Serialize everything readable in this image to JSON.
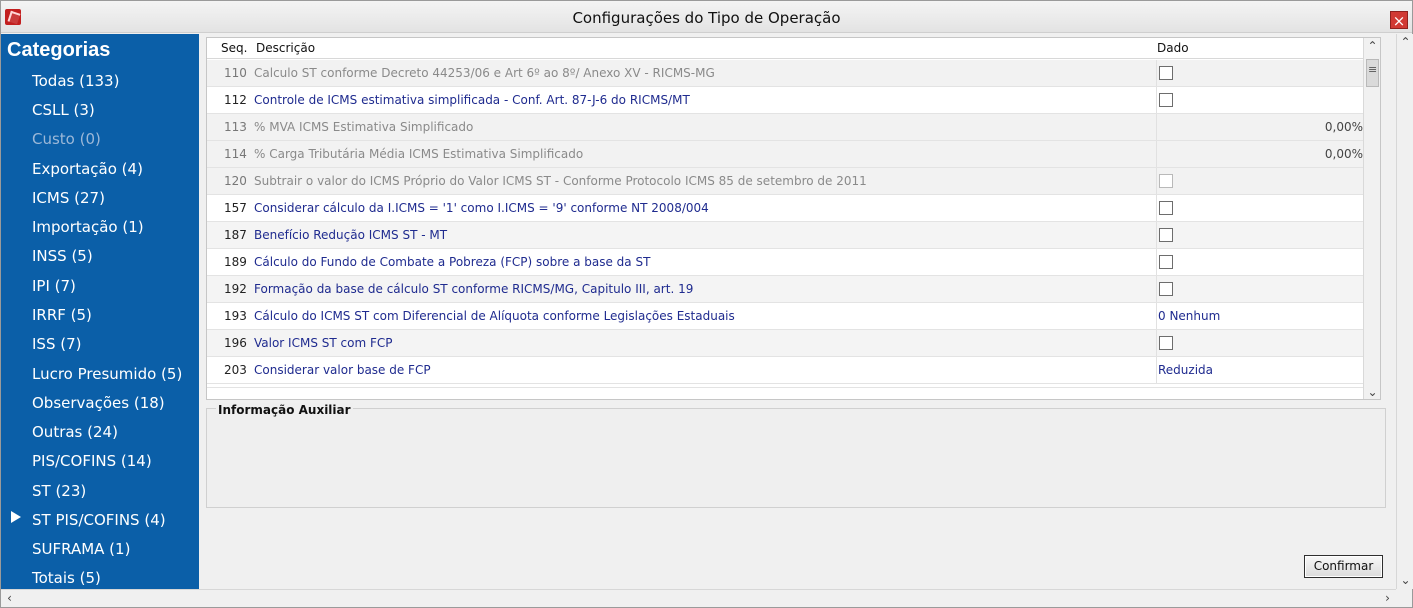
{
  "window": {
    "title": "Configurações do Tipo de Operação",
    "close_symbol": "×"
  },
  "sidebar": {
    "title": "Categorias",
    "items": [
      {
        "label": "Todas (133)",
        "disabled": false
      },
      {
        "label": "CSLL (3)",
        "disabled": false
      },
      {
        "label": "Custo (0)",
        "disabled": true
      },
      {
        "label": "Exportação (4)",
        "disabled": false
      },
      {
        "label": "ICMS (27)",
        "disabled": false
      },
      {
        "label": "Importação (1)",
        "disabled": false
      },
      {
        "label": "INSS (5)",
        "disabled": false
      },
      {
        "label": "IPI (7)",
        "disabled": false
      },
      {
        "label": "IRRF (5)",
        "disabled": false
      },
      {
        "label": "ISS (7)",
        "disabled": false
      },
      {
        "label": "Lucro Presumido (5)",
        "disabled": false
      },
      {
        "label": "Observações (18)",
        "disabled": false
      },
      {
        "label": "Outras (24)",
        "disabled": false
      },
      {
        "label": "PIS/COFINS (14)",
        "disabled": false
      },
      {
        "label": "ST (23)",
        "disabled": false,
        "selected": true
      },
      {
        "label": "ST PIS/COFINS (4)",
        "disabled": false
      },
      {
        "label": "SUFRAMA (1)",
        "disabled": false
      },
      {
        "label": "Totais (5)",
        "disabled": false
      }
    ]
  },
  "grid": {
    "columns": [
      "Seq.",
      "Descrição",
      "Dado"
    ],
    "rows": [
      {
        "seq": "110",
        "desc": "Calculo ST conforme Decreto 44253/06 e Art 6º ao 8º/ Anexo XV - RICMS-MG",
        "type": "checkbox",
        "checked": false,
        "disabled": false,
        "gray": true
      },
      {
        "seq": "112",
        "desc": "Controle de ICMS estimativa simplificada - Conf. Art. 87-J-6 do RICMS/MT",
        "type": "checkbox",
        "checked": false,
        "disabled": false,
        "gray": false
      },
      {
        "seq": "113",
        "desc": "% MVA ICMS Estimativa Simplificado",
        "type": "text-right",
        "value": "0,00%",
        "gray": true
      },
      {
        "seq": "114",
        "desc": "% Carga Tributária Média ICMS Estimativa Simplificado",
        "type": "text-right",
        "value": "0,00%",
        "gray": true
      },
      {
        "seq": "120",
        "desc": "Subtrair o valor do ICMS Próprio do Valor ICMS ST - Conforme Protocolo ICMS 85 de setembro de 2011",
        "type": "checkbox",
        "checked": false,
        "disabled": true,
        "gray": true
      },
      {
        "seq": "157",
        "desc": "Considerar cálculo da I.ICMS = '1' como I.ICMS = '9' conforme NT 2008/004",
        "type": "checkbox",
        "checked": false,
        "disabled": false,
        "gray": false
      },
      {
        "seq": "187",
        "desc": "Benefício Redução ICMS ST - MT",
        "type": "checkbox",
        "checked": false,
        "disabled": false,
        "gray": false
      },
      {
        "seq": "189",
        "desc": "Cálculo do Fundo de Combate a Pobreza (FCP) sobre a base da ST",
        "type": "checkbox",
        "checked": false,
        "disabled": false,
        "gray": false
      },
      {
        "seq": "192",
        "desc": "Formação da base de cálculo ST conforme RICMS/MG, Capitulo III, art. 19",
        "type": "checkbox",
        "checked": false,
        "disabled": false,
        "gray": false
      },
      {
        "seq": "193",
        "desc": "Cálculo do ICMS ST com Diferencial de Alíquota conforme Legislações Estaduais",
        "type": "text",
        "value": "0 Nenhum",
        "gray": false
      },
      {
        "seq": "196",
        "desc": "Valor ICMS ST com FCP",
        "type": "checkbox",
        "checked": false,
        "disabled": false,
        "gray": false
      },
      {
        "seq": "203",
        "desc": "Considerar valor base de FCP",
        "type": "text",
        "value": "Reduzida",
        "gray": false
      }
    ]
  },
  "aux": {
    "label": "Informação Auxiliar"
  },
  "actions": {
    "confirm_label": "Confirmar"
  },
  "icons": {
    "window": "app-icon",
    "close": "close-icon",
    "selected_indicator": "play-arrow-icon",
    "scroll_up": "chevron-up-icon",
    "scroll_down": "chevron-down-icon",
    "scroll_left": "chevron-left-icon",
    "scroll_right": "chevron-right-icon",
    "scroll_grip": "scroll-grip-icon"
  },
  "colors": {
    "sidebar": "#0b5fa8",
    "close": "#d13a34",
    "row_text": "#1f2b8f"
  }
}
